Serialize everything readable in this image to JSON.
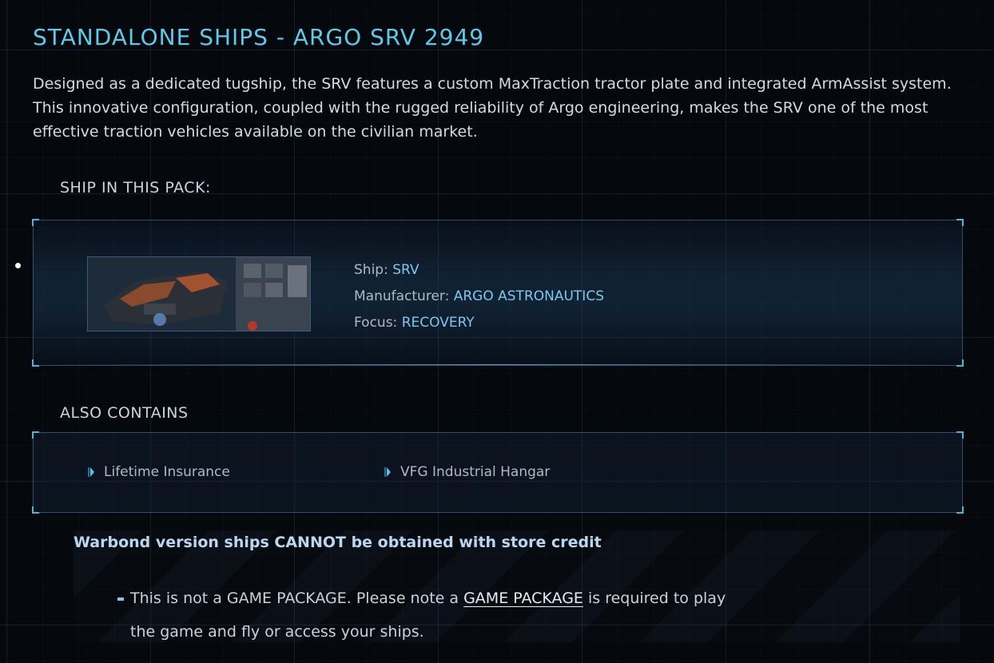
{
  "header": {
    "title": "STANDALONE SHIPS - ARGO SRV 2949",
    "description": "Designed as a dedicated tugship, the SRV features a custom MaxTraction tractor plate and integrated ArmAssist system. This innovative configuration, coupled with the rugged reliability of Argo engineering, makes the SRV one of the most effective traction vehicles available on the civilian market."
  },
  "ship_pack": {
    "heading": "SHIP IN THIS PACK:",
    "ship": {
      "ship_label": "Ship: ",
      "ship_value": "SRV",
      "manufacturer_label": "Manufacturer: ",
      "manufacturer_value": "ARGO ASTRONAUTICS",
      "focus_label": "Focus: ",
      "focus_value": "RECOVERY"
    }
  },
  "also_contains": {
    "heading": "ALSO CONTAINS",
    "items": [
      "Lifetime Insurance",
      "VFG Industrial Hangar"
    ]
  },
  "notice": {
    "warning": "Warbond version ships CANNOT be obtained with store credit",
    "note_before": "This is not a GAME PACKAGE. Please note a ",
    "note_link": "GAME PACKAGE",
    "note_after": " is required to play the game and fly or access your ships."
  },
  "colors": {
    "accent": "#5ccbe8",
    "spec_value": "#7fc7ec",
    "background": "#05080c"
  },
  "icons": {
    "list_bullet": "chevron-bullet-icon",
    "ship_thumbnail": "ship-image"
  }
}
